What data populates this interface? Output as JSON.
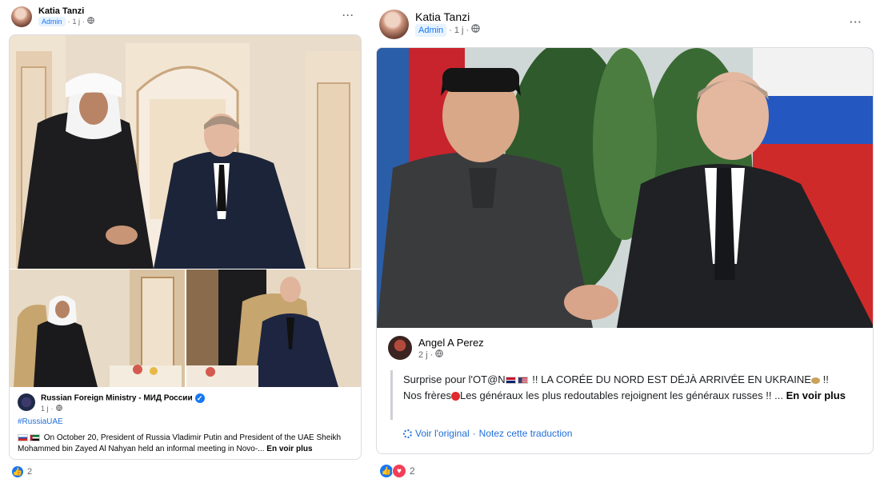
{
  "left_post": {
    "author": "Katia Tanzi",
    "role_badge": "Admin",
    "time": "1 j",
    "more_label": "···",
    "shared": {
      "source_name": "Russian Foreign Ministry - МИД России",
      "time": "1 j",
      "hashtag": "#RussiaUAE",
      "text": "On October 20, President of Russia Vladimir Putin and President of the UAE Sheikh Mohammed bin Zayed Al Nahyan held an informal meeting in Novo-...",
      "see_more": "En voir plus"
    },
    "reaction_count": "2"
  },
  "right_post": {
    "author": "Katia Tanzi",
    "role_badge": "Admin",
    "time": "1 j",
    "more_label": "···",
    "shared": {
      "source_name": "Angel A Perez",
      "time": "2 j",
      "text_part1": "Surprise pour l'OT@N",
      "text_part2": " !! LA CORÉE DU NORD EST DÉJÀ ARRIVÉE EN UKRAINE",
      "text_part3": " !!",
      "text_line2": "Nos frères",
      "text_line2b": "Les généraux les plus redoutables rejoignent les généraux russes !! ...",
      "see_more": "En voir plus",
      "see_original": "Voir l'original",
      "separator": " · ",
      "rate_translation": "Notez cette traduction"
    },
    "reaction_count": "2"
  },
  "icons": {
    "globe": "globe-icon",
    "like": "like-reaction-icon",
    "love": "love-reaction-icon",
    "verified": "verified-badge-icon",
    "translate": "translate-gear-icon"
  },
  "colors": {
    "link_blue": "#216fdb",
    "fb_blue": "#1877f2",
    "meta_grey": "#65676b",
    "love_red": "#f33e58"
  }
}
